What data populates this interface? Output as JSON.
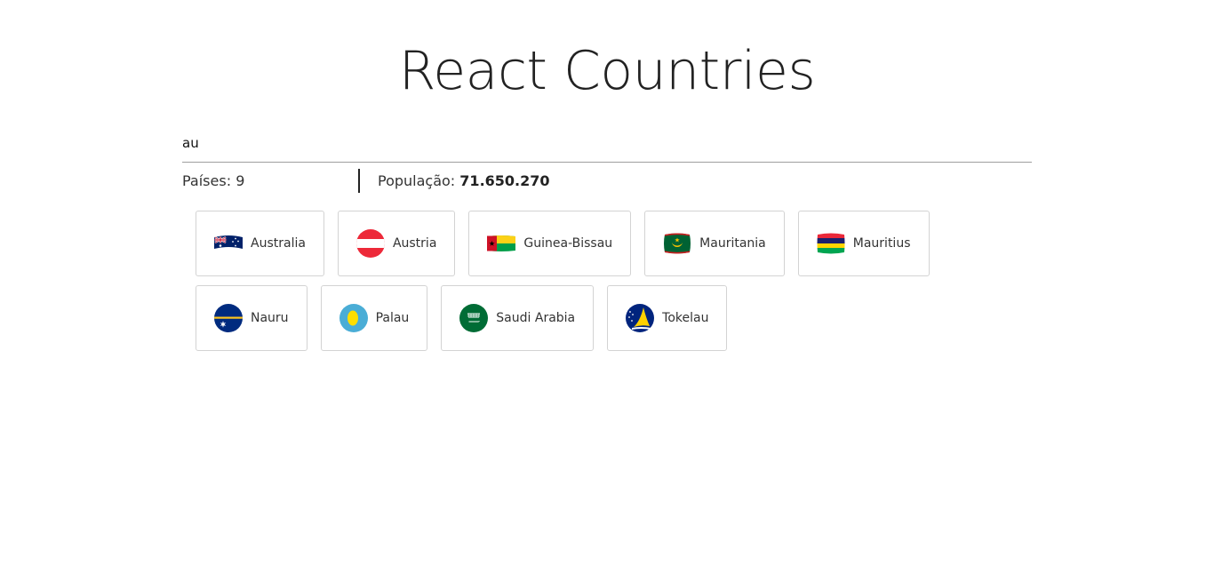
{
  "header": {
    "title": "React Countries"
  },
  "search": {
    "value": "au",
    "placeholder": ""
  },
  "summary": {
    "countries_label": "Países:",
    "countries_count": "9",
    "population_label": "População:",
    "population_value": "71.650.270"
  },
  "countries": [
    {
      "name": "Australia",
      "flag_icon": "australia-flag-icon"
    },
    {
      "name": "Austria",
      "flag_icon": "austria-flag-icon"
    },
    {
      "name": "Guinea-Bissau",
      "flag_icon": "guinea-bissau-flag-icon"
    },
    {
      "name": "Mauritania",
      "flag_icon": "mauritania-flag-icon"
    },
    {
      "name": "Mauritius",
      "flag_icon": "mauritius-flag-icon"
    },
    {
      "name": "Nauru",
      "flag_icon": "nauru-flag-icon"
    },
    {
      "name": "Palau",
      "flag_icon": "palau-flag-icon"
    },
    {
      "name": "Saudi Arabia",
      "flag_icon": "saudi-arabia-flag-icon"
    },
    {
      "name": "Tokelau",
      "flag_icon": "tokelau-flag-icon"
    }
  ],
  "colors": {
    "border": "#d3d3d3",
    "text": "#333333",
    "underline": "#9e9e9e"
  }
}
